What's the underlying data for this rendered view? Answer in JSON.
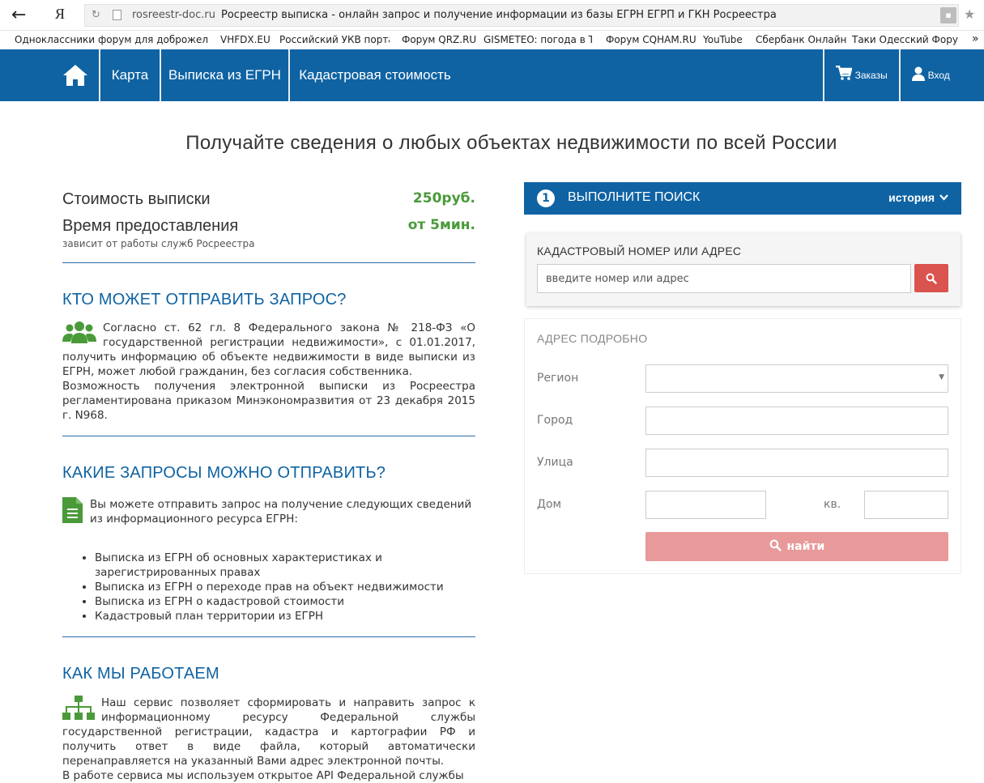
{
  "browser": {
    "domain": "rosreestr-doc.ru",
    "page_title": "Росреестр выписка - онлайн запрос и получение информации из базы ЕГРН ЕГРП и ГКН Росреестра",
    "back_glyph": "←",
    "yandex_glyph": "Я",
    "reload_glyph": "↻",
    "star_glyph": "★",
    "bookmarks": [
      "Одноклассники",
      "форум для доброжела",
      "VHFDX.EU",
      "Российский УКВ портал",
      "Форум QRZ.RU",
      "GISMETEO: погода в Т",
      "Форум CQHAM.RU",
      "YouTube",
      "Сбербанк Онлайн",
      "Таки Одесский Форум"
    ],
    "bookmarks_more": "»"
  },
  "nav": {
    "map": "Карта",
    "egrn": "Выписка из ЕГРН",
    "cadastral": "Кадастровая стоимость",
    "orders": "Заказы",
    "login": "Вход"
  },
  "headline": "Получайте сведения о любых объектах недвижимости по всей России",
  "pricing": {
    "cost_label": "Стоимость выписки",
    "cost_value": "250руб.",
    "time_label": "Время предоставления",
    "time_value": "от 5мин.",
    "time_note": "зависит от работы служб Росреестра"
  },
  "sections": {
    "who_title": "КТО МОЖЕТ ОТПРАВИТЬ ЗАПРОС?",
    "who_p1": "Согласно ст. 62 гл. 8 Федерального закона № 218-ФЗ «О государственной регистрации недвижимости», с 01.01.2017, получить информацию об объекте недвижимости в виде выписки из ЕГРН, может любой гражданин, без согласия собственника.",
    "who_p2": "Возможность получения электронной выписки из Росреестра регламентирована приказом Минэкономразвития от 23 декабря 2015 г. N968.",
    "what_title": "КАКИЕ ЗАПРОСЫ МОЖНО ОТПРАВИТЬ?",
    "what_intro": "Вы можете отправить запрос на получение следующих сведений из информационного ресурса ЕГРН:",
    "what_list": [
      "Выписка из ЕГРН об основных характеристиках и зарегистрированных правах",
      "Выписка из ЕГРН о переходе прав на объект недвижимости",
      "Выписка из ЕГРН о кадастровой стоимости",
      "Кадастровый план территории из ЕГРН"
    ],
    "how_title": "КАК МЫ РАБОТАЕМ",
    "how_p1": "Наш сервис позволяет сформировать и направить запрос к информационному ресурсу Федеральной службы государственной регистрации, кадастра и картографии РФ и получить ответ в виде файла, который автоматически перенаправляется на указанный Вами адрес электронной почты.",
    "how_p2": "В работе сервиса мы используем открытое API Федеральной службы"
  },
  "search": {
    "step": "1",
    "title": "ВЫПОЛНИТЕ ПОИСК",
    "history": "история",
    "cad_label": "КАДАСТРОВЫЙ НОМЕР ИЛИ АДРЕС",
    "cad_placeholder": "введите номер или адрес",
    "address_title": "АДРЕС ПОДРОБНО",
    "region": "Регион",
    "city": "Город",
    "street": "Улица",
    "house": "Дом",
    "apt": "кв.",
    "find": "найти"
  },
  "colors": {
    "brand": "#0f63a3",
    "green": "#4a9a3a",
    "danger": "#d9534f",
    "find_btn": "#e8999a"
  }
}
